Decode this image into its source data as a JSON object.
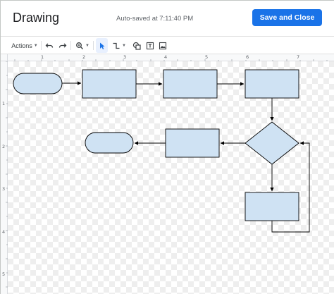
{
  "header": {
    "title": "Drawing",
    "autosave_text": "Auto-saved at 7:11:40 PM",
    "save_close_label": "Save and Close"
  },
  "toolbar": {
    "actions_label": "Actions",
    "items": [
      "undo-icon",
      "redo-icon",
      "zoom-icon",
      "select-icon",
      "line-icon",
      "shape-icon",
      "text-box-icon",
      "image-icon"
    ]
  },
  "ruler": {
    "top_labels": [
      "1",
      "2",
      "3",
      "4",
      "5",
      "6",
      "7"
    ],
    "left_labels": [
      "1",
      "2",
      "3",
      "4",
      "5"
    ]
  },
  "colors": {
    "accent": "#1a73e8",
    "shape_fill": "#cfe2f3",
    "shape_stroke": "#000000"
  },
  "diagram": {
    "shapes": [
      "rounded-terminal",
      "rect",
      "rect",
      "rect",
      "diamond",
      "rect",
      "rounded-terminal",
      "rect"
    ],
    "connector_count": 7
  }
}
